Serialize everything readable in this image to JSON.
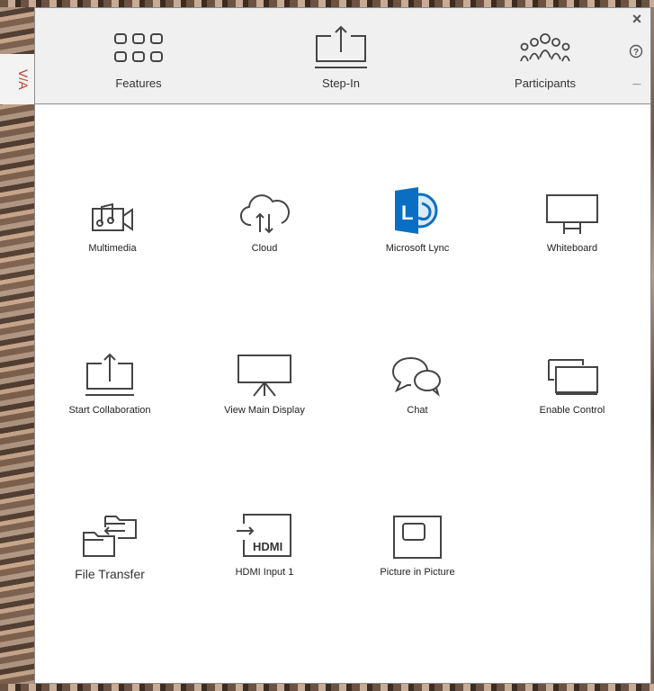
{
  "header": {
    "nav": [
      {
        "label": "Features",
        "icon": "grid-dots-icon"
      },
      {
        "label": "Step-In",
        "icon": "share-screen-icon"
      },
      {
        "label": "Participants",
        "icon": "participants-icon"
      }
    ],
    "controls": {
      "close": "×",
      "help": "?",
      "minimize": "_"
    }
  },
  "logo": {
    "text": "V/A"
  },
  "features": [
    {
      "label": "Multimedia",
      "icon": "multimedia-icon"
    },
    {
      "label": "Cloud",
      "icon": "cloud-icon"
    },
    {
      "label": "Microsoft Lync",
      "icon": "microsoft-lync-icon"
    },
    {
      "label": "Whiteboard",
      "icon": "whiteboard-icon"
    },
    {
      "label": "Start Collaboration",
      "icon": "collaboration-icon"
    },
    {
      "label": "View Main Display",
      "icon": "main-display-icon"
    },
    {
      "label": "Chat",
      "icon": "chat-icon"
    },
    {
      "label": "Enable Control",
      "icon": "enable-control-icon"
    },
    {
      "label": "File Transfer",
      "icon": "file-transfer-icon"
    },
    {
      "label": "HDMI Input 1",
      "icon": "hdmi-icon",
      "badge": "HDMI"
    },
    {
      "label": "Picture in Picture",
      "icon": "picture-in-picture-icon"
    }
  ],
  "colors": {
    "lync_blue": "#0a6fc2",
    "header_bg": "#f0f0f0",
    "logo_red": "#c0392b"
  }
}
